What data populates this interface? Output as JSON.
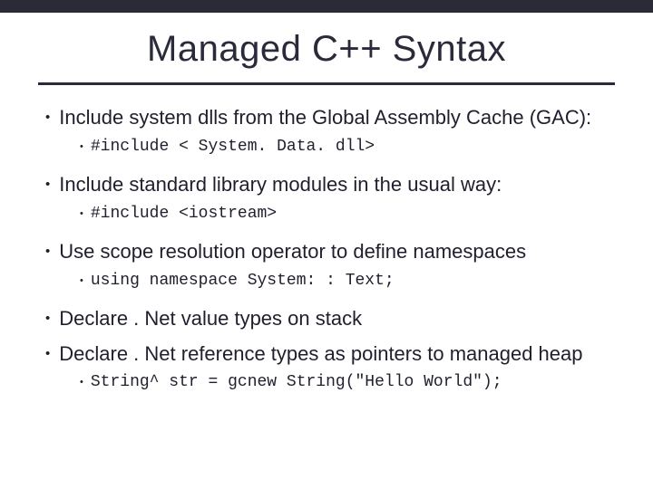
{
  "title": "Managed C++ Syntax",
  "bullets": {
    "b1": "Include system dlls from the Global Assembly Cache (GAC):",
    "b1a": "#include < System. Data. dll>",
    "b2": "Include standard library modules in the usual way:",
    "b2a": "#include <iostream>",
    "b3": "Use scope resolution operator to define namespaces",
    "b3a": "using namespace System: : Text;",
    "b4": "Declare . Net value types on stack",
    "b5": "Declare . Net reference types as pointers to managed heap",
    "b5a": "String^ str = gcnew String(\"Hello World\");"
  }
}
